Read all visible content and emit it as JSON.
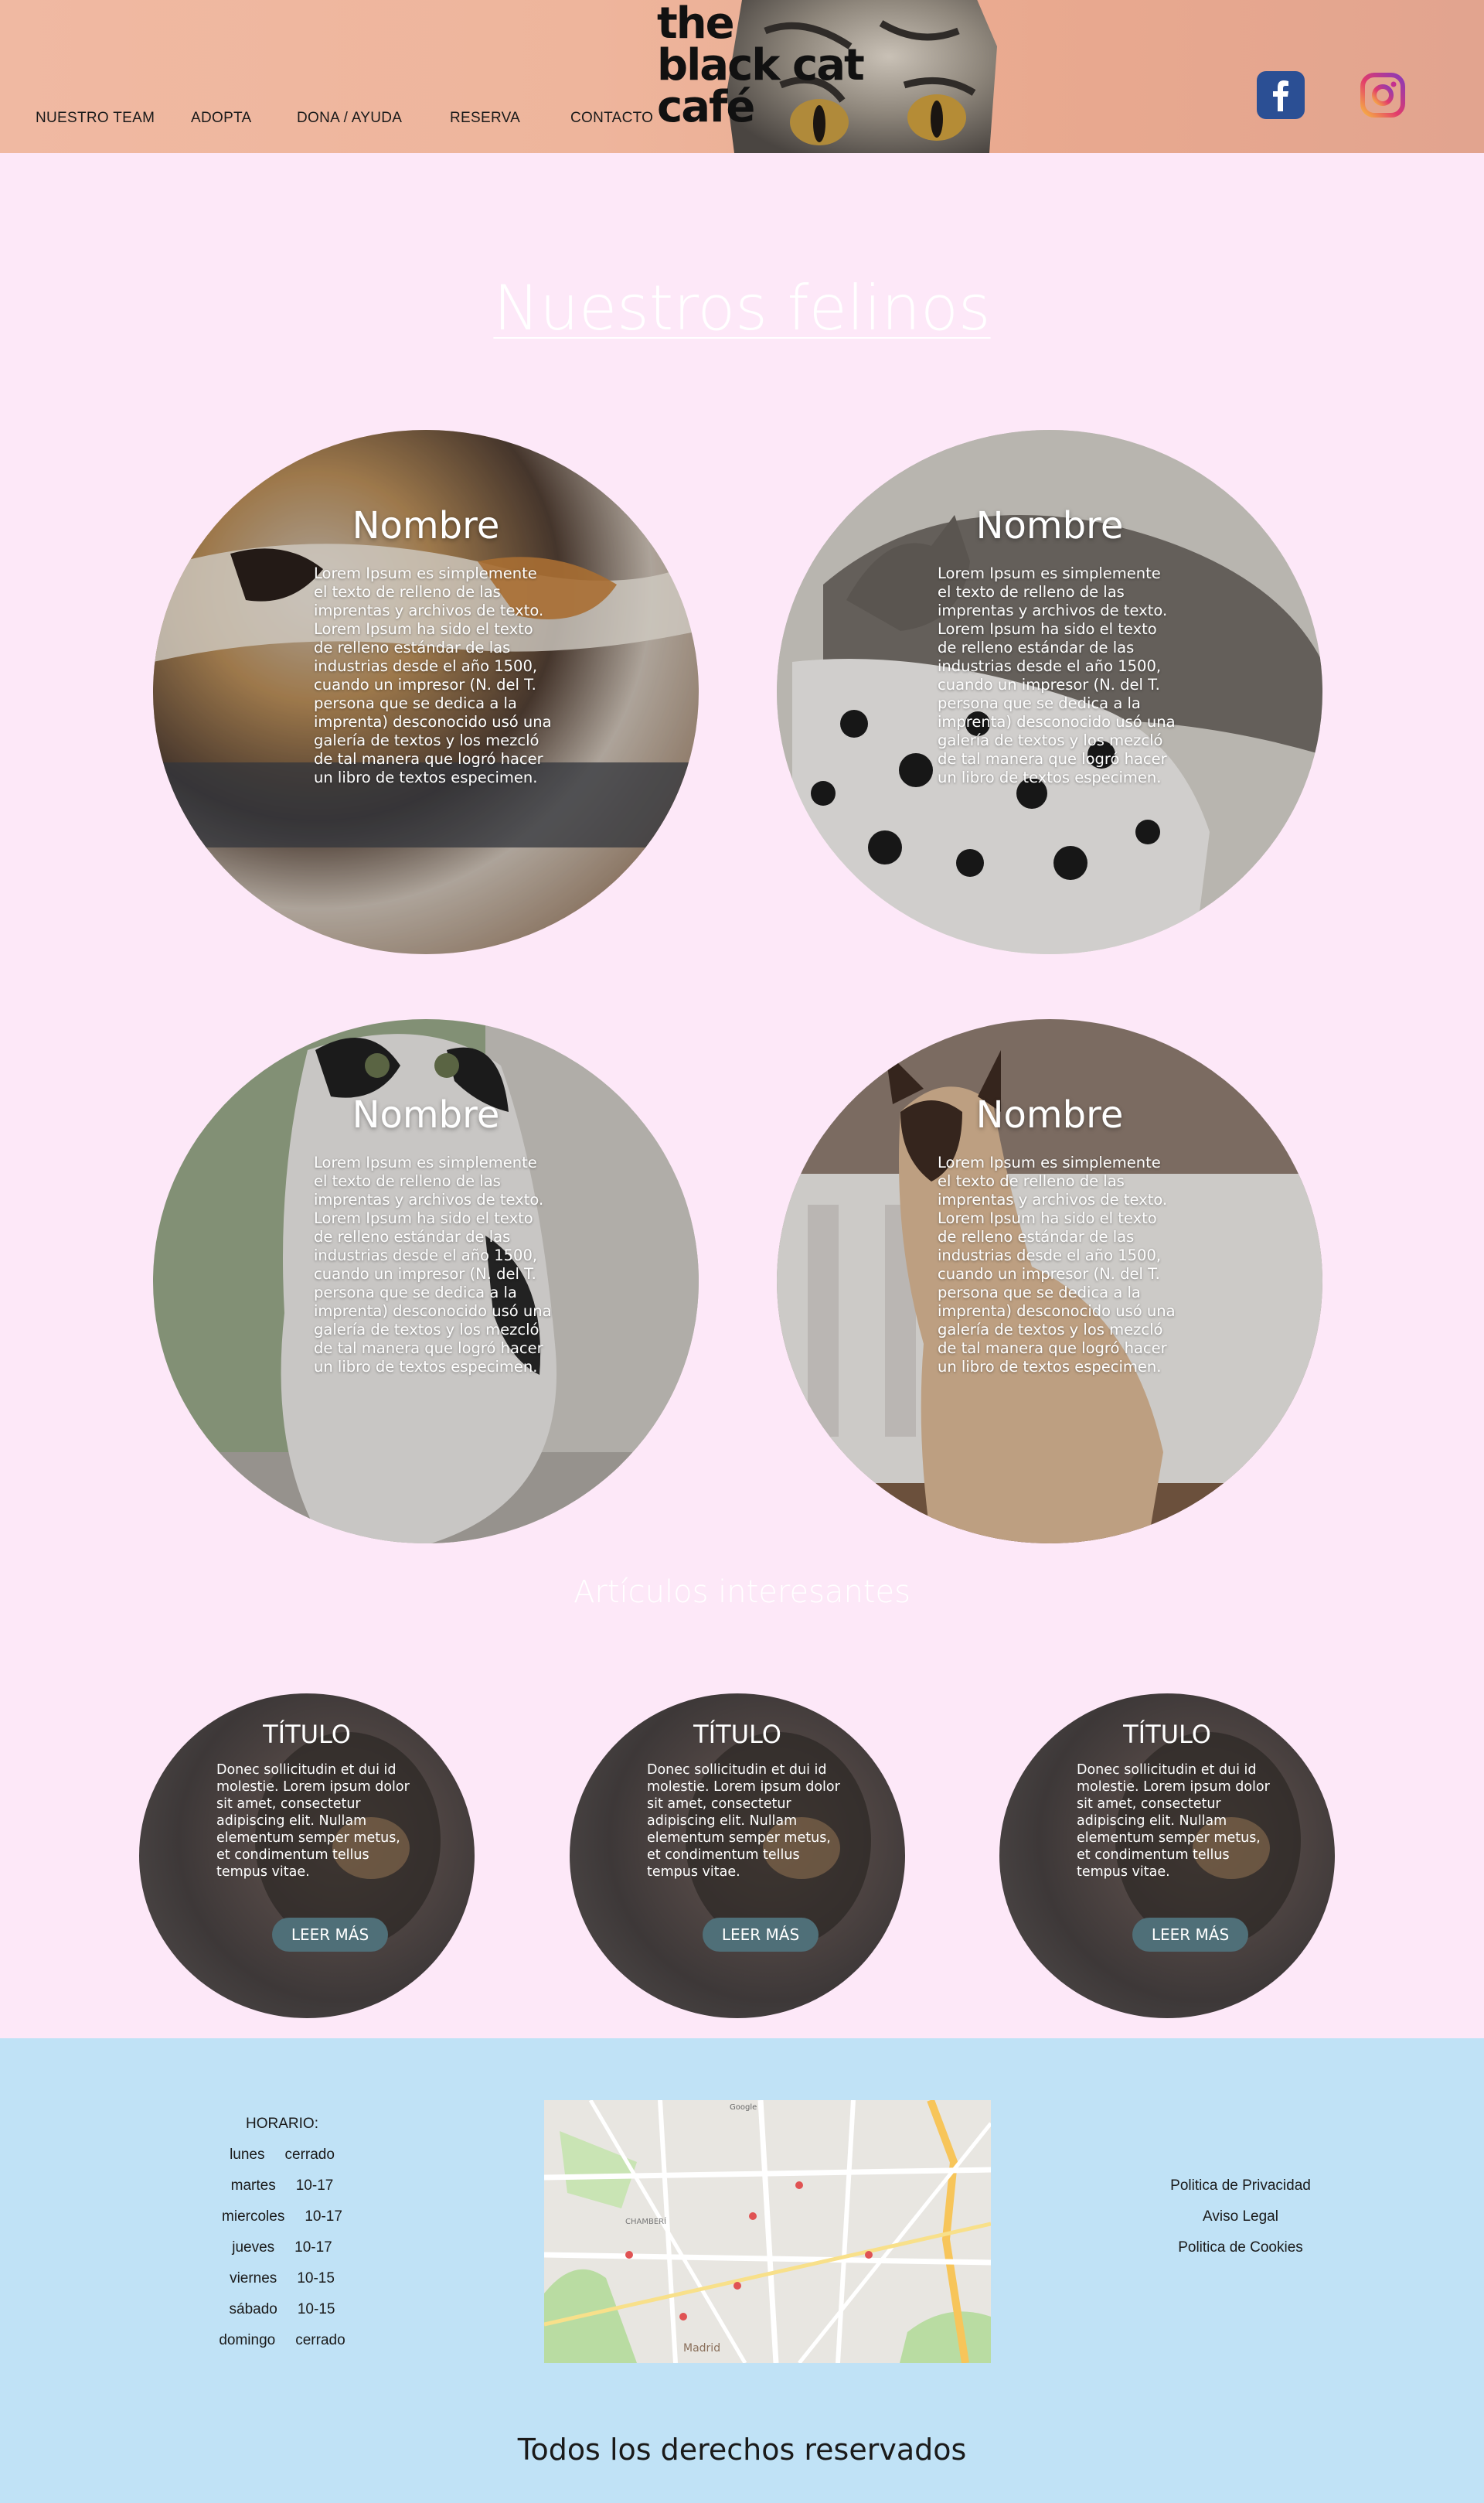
{
  "nav": {
    "items": [
      "NUESTRO TEAM",
      "ADOPTA",
      "DONA / AYUDA",
      "RESERVA",
      "CONTACTO"
    ]
  },
  "logo": {
    "line1": "the",
    "line2": "black cat",
    "line3": "café"
  },
  "social": {
    "facebook": "facebook-icon",
    "instagram": "instagram-icon"
  },
  "main": {
    "title": "Nuestros felinos",
    "cats": [
      {
        "name": "Nombre",
        "desc": "Lorem Ipsum es simplemente el texto de relleno de las imprentas y archivos de texto. Lorem Ipsum ha sido el texto de relleno estándar de las industrias desde el año 1500, cuando un impresor (N. del T. persona que se dedica a la imprenta) desconocido usó una galería de textos y los mezcló de tal manera que logró hacer un libro de textos especimen."
      },
      {
        "name": "Nombre",
        "desc": "Lorem Ipsum es simplemente el texto de relleno de las imprentas y archivos de texto. Lorem Ipsum ha sido el texto de relleno estándar de las industrias desde el año 1500, cuando un impresor (N. del T. persona que se dedica a la imprenta) desconocido usó una galería de textos y los mezcló de tal manera que logró hacer un libro de textos especimen."
      },
      {
        "name": "Nombre",
        "desc": "Lorem Ipsum es simplemente el texto de relleno de las imprentas y archivos de texto. Lorem Ipsum ha sido el texto de relleno estándar de las industrias desde el año 1500, cuando un impresor (N. del T. persona que se dedica a la imprenta) desconocido usó una galería de textos y los mezcló de tal manera que logró hacer un libro de textos especimen."
      },
      {
        "name": "Nombre",
        "desc": "Lorem Ipsum es simplemente el texto de relleno de las imprentas y archivos de texto. Lorem Ipsum ha sido el texto de relleno estándar de las industrias desde el año 1500, cuando un impresor (N. del T. persona que se dedica a la imprenta) desconocido usó una galería de textos y los mezcló de tal manera que logró hacer un libro de textos especimen."
      }
    ]
  },
  "articles": {
    "title": "Artículos interesantes",
    "items": [
      {
        "title": "TÍTULO",
        "desc": "Donec sollicitudin et dui id molestie. Lorem ipsum dolor sit amet, consectetur adipiscing elit. Nullam elementum semper metus, et condimentum tellus tempus vitae.",
        "button": "LEER MÁS"
      },
      {
        "title": "TÍTULO",
        "desc": "Donec sollicitudin et dui id molestie. Lorem ipsum dolor sit amet, consectetur adipiscing elit. Nullam elementum semper metus, et condimentum tellus tempus vitae.",
        "button": "LEER MÁS"
      },
      {
        "title": "TÍTULO",
        "desc": "Donec sollicitudin et dui id molestie. Lorem ipsum dolor sit amet, consectetur adipiscing elit. Nullam elementum semper metus, et condimentum tellus tempus vitae.",
        "button": "LEER MÁS"
      }
    ]
  },
  "footer": {
    "hours_title": "HORARIO:",
    "hours": [
      {
        "day": "lunes",
        "time": "cerrado"
      },
      {
        "day": "martes",
        "time": "10-17"
      },
      {
        "day": "miercoles",
        "time": "10-17"
      },
      {
        "day": "jueves",
        "time": "10-17"
      },
      {
        "day": "viernes",
        "time": "10-15"
      },
      {
        "day": "sábado",
        "time": "10-15"
      },
      {
        "day": "domingo",
        "time": "cerrado"
      }
    ],
    "links": [
      "Politica de Privacidad",
      "Aviso Legal",
      "Politica de Cookies"
    ],
    "rights": "Todos los derechos reservados",
    "map_labels": [
      "CHAMBERÍ",
      "Madrid",
      "Google"
    ]
  },
  "colors": {
    "page_bg": "#fde8f8",
    "header_bg": "#eeb59c",
    "footer_bg": "#c0e2f6",
    "facebook": "#2b4f94",
    "button": "#4f6f78"
  }
}
